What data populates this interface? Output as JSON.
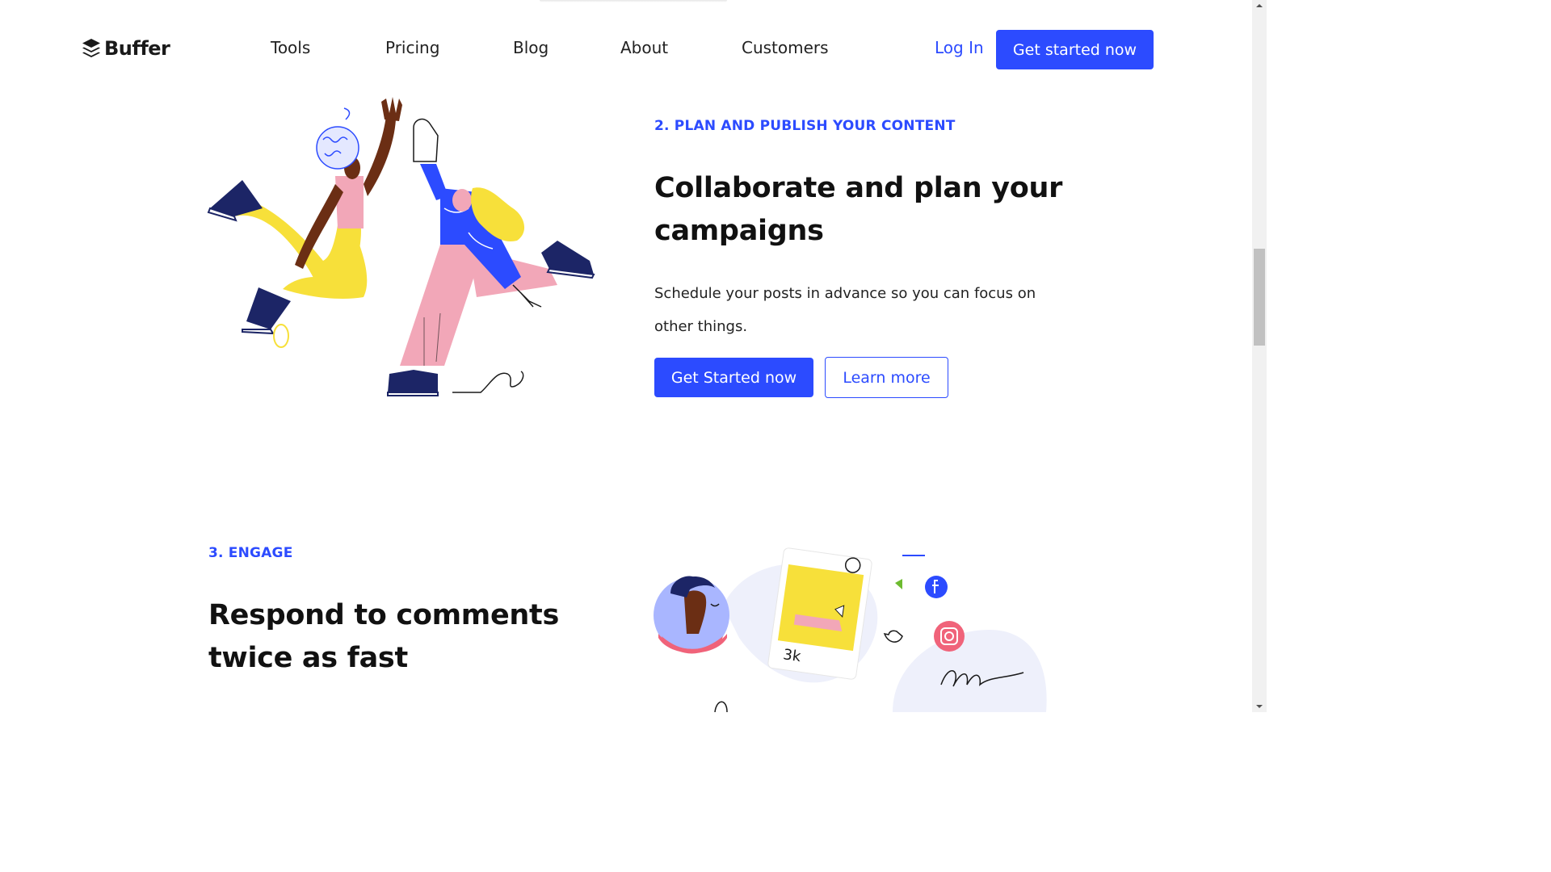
{
  "header": {
    "logo_text": "Buffer",
    "nav": [
      "Tools",
      "Pricing",
      "Blog",
      "About",
      "Customers"
    ],
    "login_label": "Log In",
    "cta_label": "Get started now"
  },
  "section_plan": {
    "eyebrow": "2. PLAN AND PUBLISH YOUR CONTENT",
    "heading_line1": "Collaborate and plan your",
    "heading_line2": "campaigns",
    "body_line1": "Schedule your posts in advance so you can focus on",
    "body_line2": "other things.",
    "primary_button": "Get Started now",
    "secondary_button": "Learn more"
  },
  "section_engage": {
    "eyebrow": "3. ENGAGE",
    "heading_line1": "Respond to comments",
    "heading_line2": "twice as fast",
    "like_count": "3k"
  },
  "colors": {
    "brand_blue": "#2c4bff",
    "illustration_yellow": "#f7e03a",
    "illustration_pink": "#f2a7b8",
    "illustration_navy": "#1c2566",
    "instagram_pink": "#f0637a"
  }
}
